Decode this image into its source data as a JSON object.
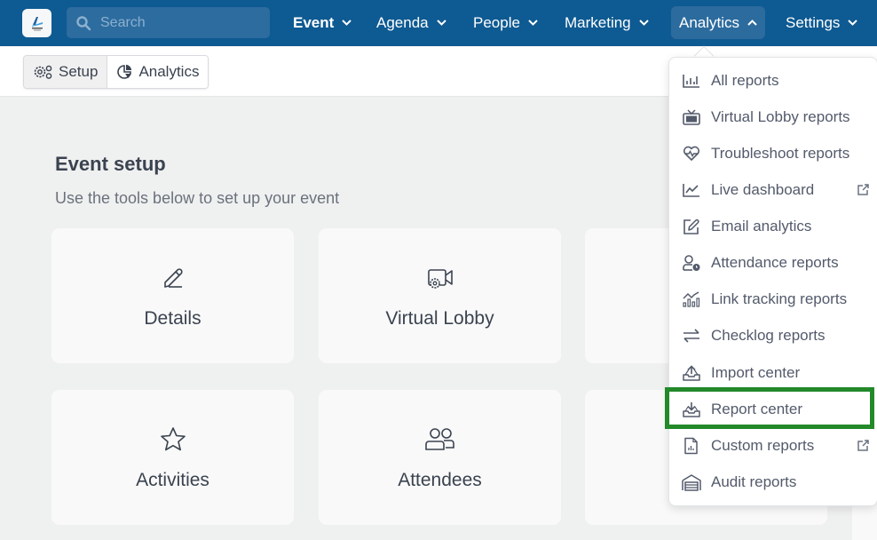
{
  "topbar": {
    "logo_icon": "event-logo",
    "search": {
      "placeholder": "Search",
      "icon": "search-icon"
    },
    "nav": [
      {
        "label": "Event",
        "bold": true,
        "expanded": false
      },
      {
        "label": "Agenda",
        "expanded": false
      },
      {
        "label": "People",
        "expanded": false
      },
      {
        "label": "Marketing",
        "expanded": false
      },
      {
        "label": "Analytics",
        "expanded": true,
        "active": true
      },
      {
        "label": "Settings",
        "expanded": false
      }
    ]
  },
  "subbar": {
    "tabs": [
      {
        "label": "Setup",
        "icon": "gears-icon",
        "selected": true
      },
      {
        "label": "Analytics",
        "icon": "pie-chart-icon",
        "selected": false
      }
    ]
  },
  "main": {
    "title": "Event setup",
    "subtitle": "Use the tools below to set up your event",
    "cards": [
      {
        "label": "Details",
        "icon": "pencil-icon"
      },
      {
        "label": "Virtual Lobby",
        "icon": "video-gear-icon"
      },
      {
        "label": "",
        "icon": ""
      },
      {
        "label": "Activities",
        "icon": "star-icon"
      },
      {
        "label": "Attendees",
        "icon": "people-icon"
      },
      {
        "label": "",
        "icon": ""
      }
    ]
  },
  "analytics_menu": {
    "items": [
      {
        "label": "All reports",
        "icon": "bar-chart-icon",
        "external": false
      },
      {
        "label": "Virtual Lobby reports",
        "icon": "tv-icon",
        "external": false
      },
      {
        "label": "Troubleshoot reports",
        "icon": "heartbeat-icon",
        "external": false
      },
      {
        "label": "Live dashboard",
        "icon": "line-chart-icon",
        "external": true
      },
      {
        "label": "Email analytics",
        "icon": "edit-icon",
        "external": false
      },
      {
        "label": "Attendance reports",
        "icon": "user-clock-icon",
        "external": false
      },
      {
        "label": "Link tracking reports",
        "icon": "trend-bars-icon",
        "external": false
      },
      {
        "label": "Checklog reports",
        "icon": "swap-arrows-icon",
        "external": false
      },
      {
        "label": "Import center",
        "icon": "inbox-upload-icon",
        "external": false
      },
      {
        "label": "Report center",
        "icon": "inbox-download-icon",
        "external": false,
        "highlighted": true
      },
      {
        "label": "Custom reports",
        "icon": "file-chart-icon",
        "external": true
      },
      {
        "label": "Audit reports",
        "icon": "garage-icon",
        "external": false
      }
    ],
    "highlight_color": "#23892a"
  },
  "colors": {
    "topbar": "#0e5a92",
    "nav_active": "#2c6b9e",
    "background": "#eff0f0",
    "card": "#f9f9f9"
  }
}
